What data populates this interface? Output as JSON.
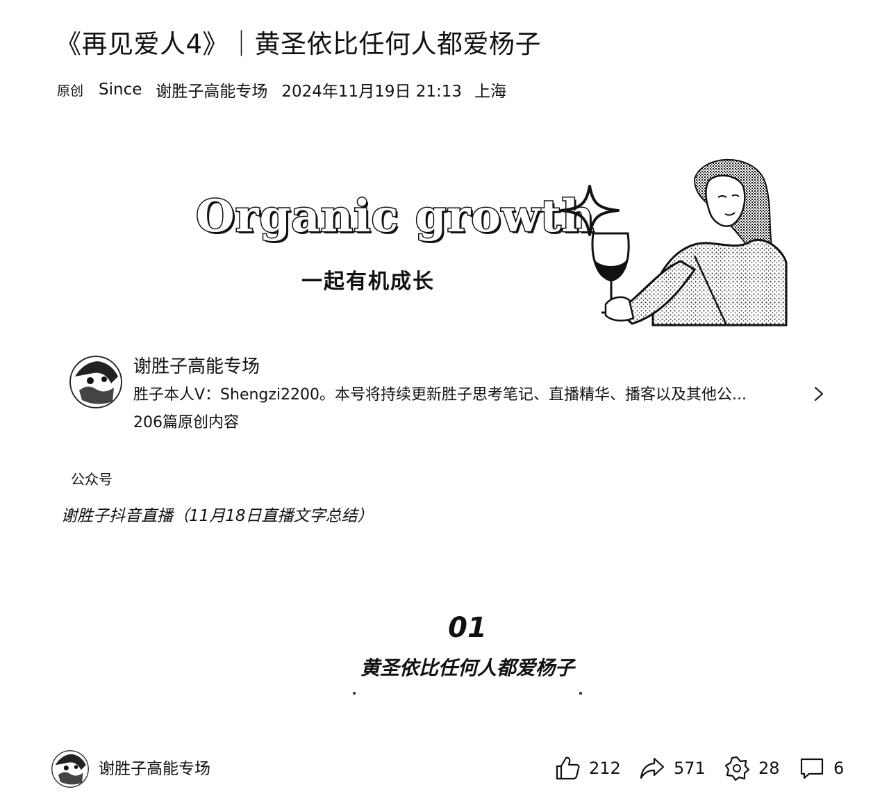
{
  "article": {
    "title": "《再见爱人4》｜黄圣依比任何人都爱杨子",
    "meta": {
      "original_badge": "原创",
      "author": "Since",
      "account": "谢胜子高能专场",
      "datetime": "2024年11月19日 21:13",
      "location": "上海"
    }
  },
  "banner": {
    "english": "Organic growth",
    "chinese": "一起有机成长"
  },
  "account_card": {
    "name": "谢胜子高能专场",
    "description": "胜子本人V：Shengzi2200。本号将持续更新胜子思考笔记、直播精华、播客以及其他公...",
    "article_count": "206篇原创内容",
    "type_label": "公众号"
  },
  "content": {
    "subtitle": "谢胜子抖音直播（11月18日直播文字总结）",
    "section_number": "01",
    "section_title": "黄圣依比任何人都爱杨子"
  },
  "bottom_bar": {
    "account_name": "谢胜子高能专场",
    "likes": "212",
    "shares": "571",
    "wows": "28",
    "comments": "6"
  },
  "icons": {
    "like": "thumbs-up-icon",
    "share": "share-arrow-icon",
    "wow": "star-flower-icon",
    "comment": "comment-bubble-icon",
    "card_arrow": "chevron-right-icon"
  }
}
